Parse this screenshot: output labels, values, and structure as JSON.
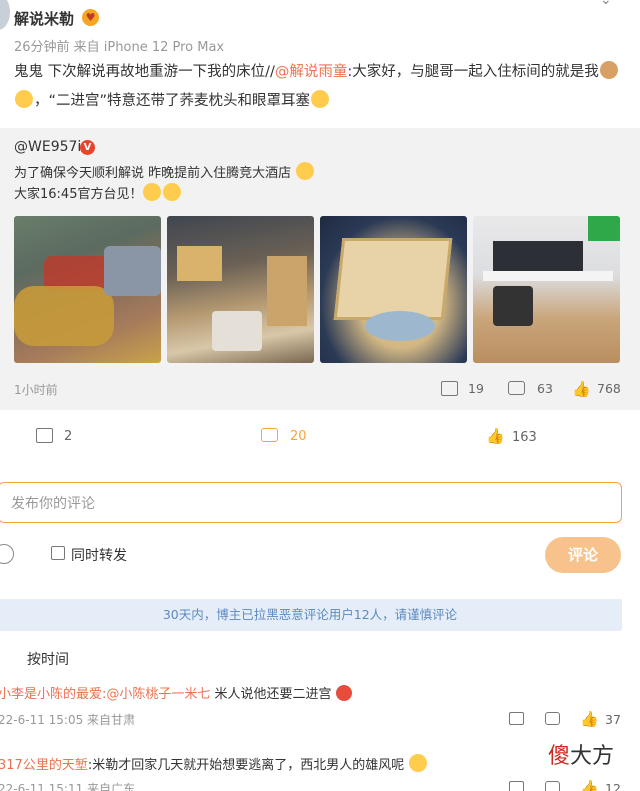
{
  "post": {
    "author": "解说米勒",
    "meta": "26分钟前  来自 iPhone 12 Pro Max",
    "text_1": "鬼鬼 下次解说再故地重游一下我的床位//",
    "mention": "@解说雨童",
    "text_2": ":大家好，与腿哥一起入住标间的就是我",
    "text_3": "，“二进宫”特意还带了荞麦枕头和眼罩耳塞"
  },
  "repost": {
    "author": "@WE957i",
    "line1": "为了确保今天顺利解说 昨晚提前入住腾竞大酒店",
    "line2": "大家16:45官方台见！",
    "time": "1小时前",
    "shares": "19",
    "comments": "63",
    "likes": "768"
  },
  "actions": {
    "shares": "2",
    "comments": "20",
    "likes": "163"
  },
  "comment_box": {
    "placeholder": "发布你的评论",
    "repost_label": "同时转发",
    "submit_label": "评论"
  },
  "notice": "30天内，博主已拉黑恶意评论用户12人，请谨慎评论",
  "sort_label": "按时间",
  "comments": [
    {
      "user": "小李是小陈的最爱",
      "mention": ":@小陈桃子一米七",
      "text": " 米人说他还要二进宫",
      "meta": "22-6-11 15:05 来自甘肃",
      "likes": "37"
    },
    {
      "user": "317公里的天堑",
      "text": ":米勒才回家几天就开始想要逃离了，西北男人的雄风呢",
      "meta": "22-6-11 15:11 来自广东",
      "likes": "12"
    }
  ],
  "watermark": {
    "red": "傻",
    "black": "大方"
  },
  "colors": {
    "accent_orange": "#f5a63a",
    "mention": "#eb7350",
    "notice_text": "#5d89bf",
    "notice_bg": "#e5eef8"
  }
}
